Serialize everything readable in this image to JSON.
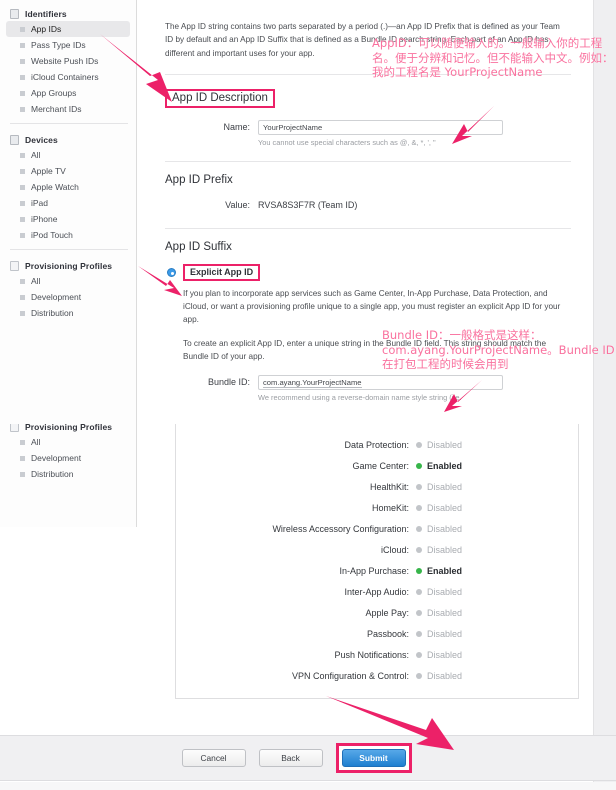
{
  "sidebar": {
    "groups": [
      {
        "header": "Identifiers",
        "header_icon": "id-card-icon",
        "items": [
          {
            "label": "App IDs",
            "selected": true
          },
          {
            "label": "Pass Type IDs",
            "selected": false
          },
          {
            "label": "Website Push IDs",
            "selected": false
          },
          {
            "label": "iCloud Containers",
            "selected": false
          },
          {
            "label": "App Groups",
            "selected": false
          },
          {
            "label": "Merchant IDs",
            "selected": false
          }
        ]
      },
      {
        "header": "Devices",
        "header_icon": "device-icon",
        "items": [
          {
            "label": "All",
            "selected": false
          },
          {
            "label": "Apple TV",
            "selected": false
          },
          {
            "label": "Apple Watch",
            "selected": false
          },
          {
            "label": "iPad",
            "selected": false
          },
          {
            "label": "iPhone",
            "selected": false
          },
          {
            "label": "iPod Touch",
            "selected": false
          }
        ]
      },
      {
        "header": "Provisioning Profiles",
        "header_icon": "document-icon",
        "items": [
          {
            "label": "All",
            "selected": false
          },
          {
            "label": "Development",
            "selected": false
          },
          {
            "label": "Distribution",
            "selected": false
          }
        ]
      }
    ]
  },
  "top_pane": {
    "intro_paragraph": "The App ID string contains two parts separated by a period (.)—an App ID Prefix that is defined as your Team ID by default and an App ID Suffix that is defined as a Bundle ID search string. Each part of an App ID has different and important uses for your app.",
    "description_section": {
      "title": "App ID Description",
      "name_label": "Name:",
      "name_value": "YourProjectName",
      "name_hint": "You cannot use special characters such as @, &, *, ', \""
    },
    "prefix_section": {
      "title": "App ID Prefix",
      "value_label": "Value:",
      "value": "RVSA8S3F7R (Team ID)"
    },
    "suffix_section": {
      "title": "App ID Suffix",
      "explicit_label": "Explicit App ID",
      "explicit_selected": true,
      "paragraph_1": "If you plan to incorporate app services such as Game Center, In-App Purchase, Data Protection, and iCloud, or want a provisioning profile unique to a single app, you must register an explicit App ID for your app.",
      "paragraph_2": "To create an explicit App ID, enter a unique string in the Bundle ID field. This string should match the Bundle ID of your app.",
      "bundle_label": "Bundle ID:",
      "bundle_value": "com.ayang.YourProjectName",
      "bundle_hint": "We recommend using a reverse-domain name style string (i.e."
    }
  },
  "bottom_pane": {
    "services": [
      {
        "name": "Data Protection:",
        "state": "Disabled",
        "enabled": false
      },
      {
        "name": "Game Center:",
        "state": "Enabled",
        "enabled": true
      },
      {
        "name": "HealthKit:",
        "state": "Disabled",
        "enabled": false
      },
      {
        "name": "HomeKit:",
        "state": "Disabled",
        "enabled": false
      },
      {
        "name": "Wireless Accessory Configuration:",
        "state": "Disabled",
        "enabled": false
      },
      {
        "name": "iCloud:",
        "state": "Disabled",
        "enabled": false
      },
      {
        "name": "In-App Purchase:",
        "state": "Enabled",
        "enabled": true
      },
      {
        "name": "Inter-App Audio:",
        "state": "Disabled",
        "enabled": false
      },
      {
        "name": "Apple Pay:",
        "state": "Disabled",
        "enabled": false
      },
      {
        "name": "Passbook:",
        "state": "Disabled",
        "enabled": false
      },
      {
        "name": "Push Notifications:",
        "state": "Disabled",
        "enabled": false
      },
      {
        "name": "VPN Configuration & Control:",
        "state": "Disabled",
        "enabled": false
      }
    ],
    "footer": {
      "cancel_label": "Cancel",
      "back_label": "Back",
      "submit_label": "Submit"
    }
  },
  "annotations": {
    "appid_note": "AppID：可以随便输入的。一般输入你的工程名。便于分辨和记忆。但不能输入中文。例如：我的工程名是 YourProjectName",
    "bundle_note": "Bundle ID：一般格式是这样：com.ayang.YourProjectName。Bundle ID在打包工程的时候会用到"
  },
  "colors": {
    "annotation_pink": "#f9719e",
    "highlight_pink": "#ec2168",
    "enabled_green": "#37b54a",
    "primary_blue": "#1f7fd0"
  }
}
